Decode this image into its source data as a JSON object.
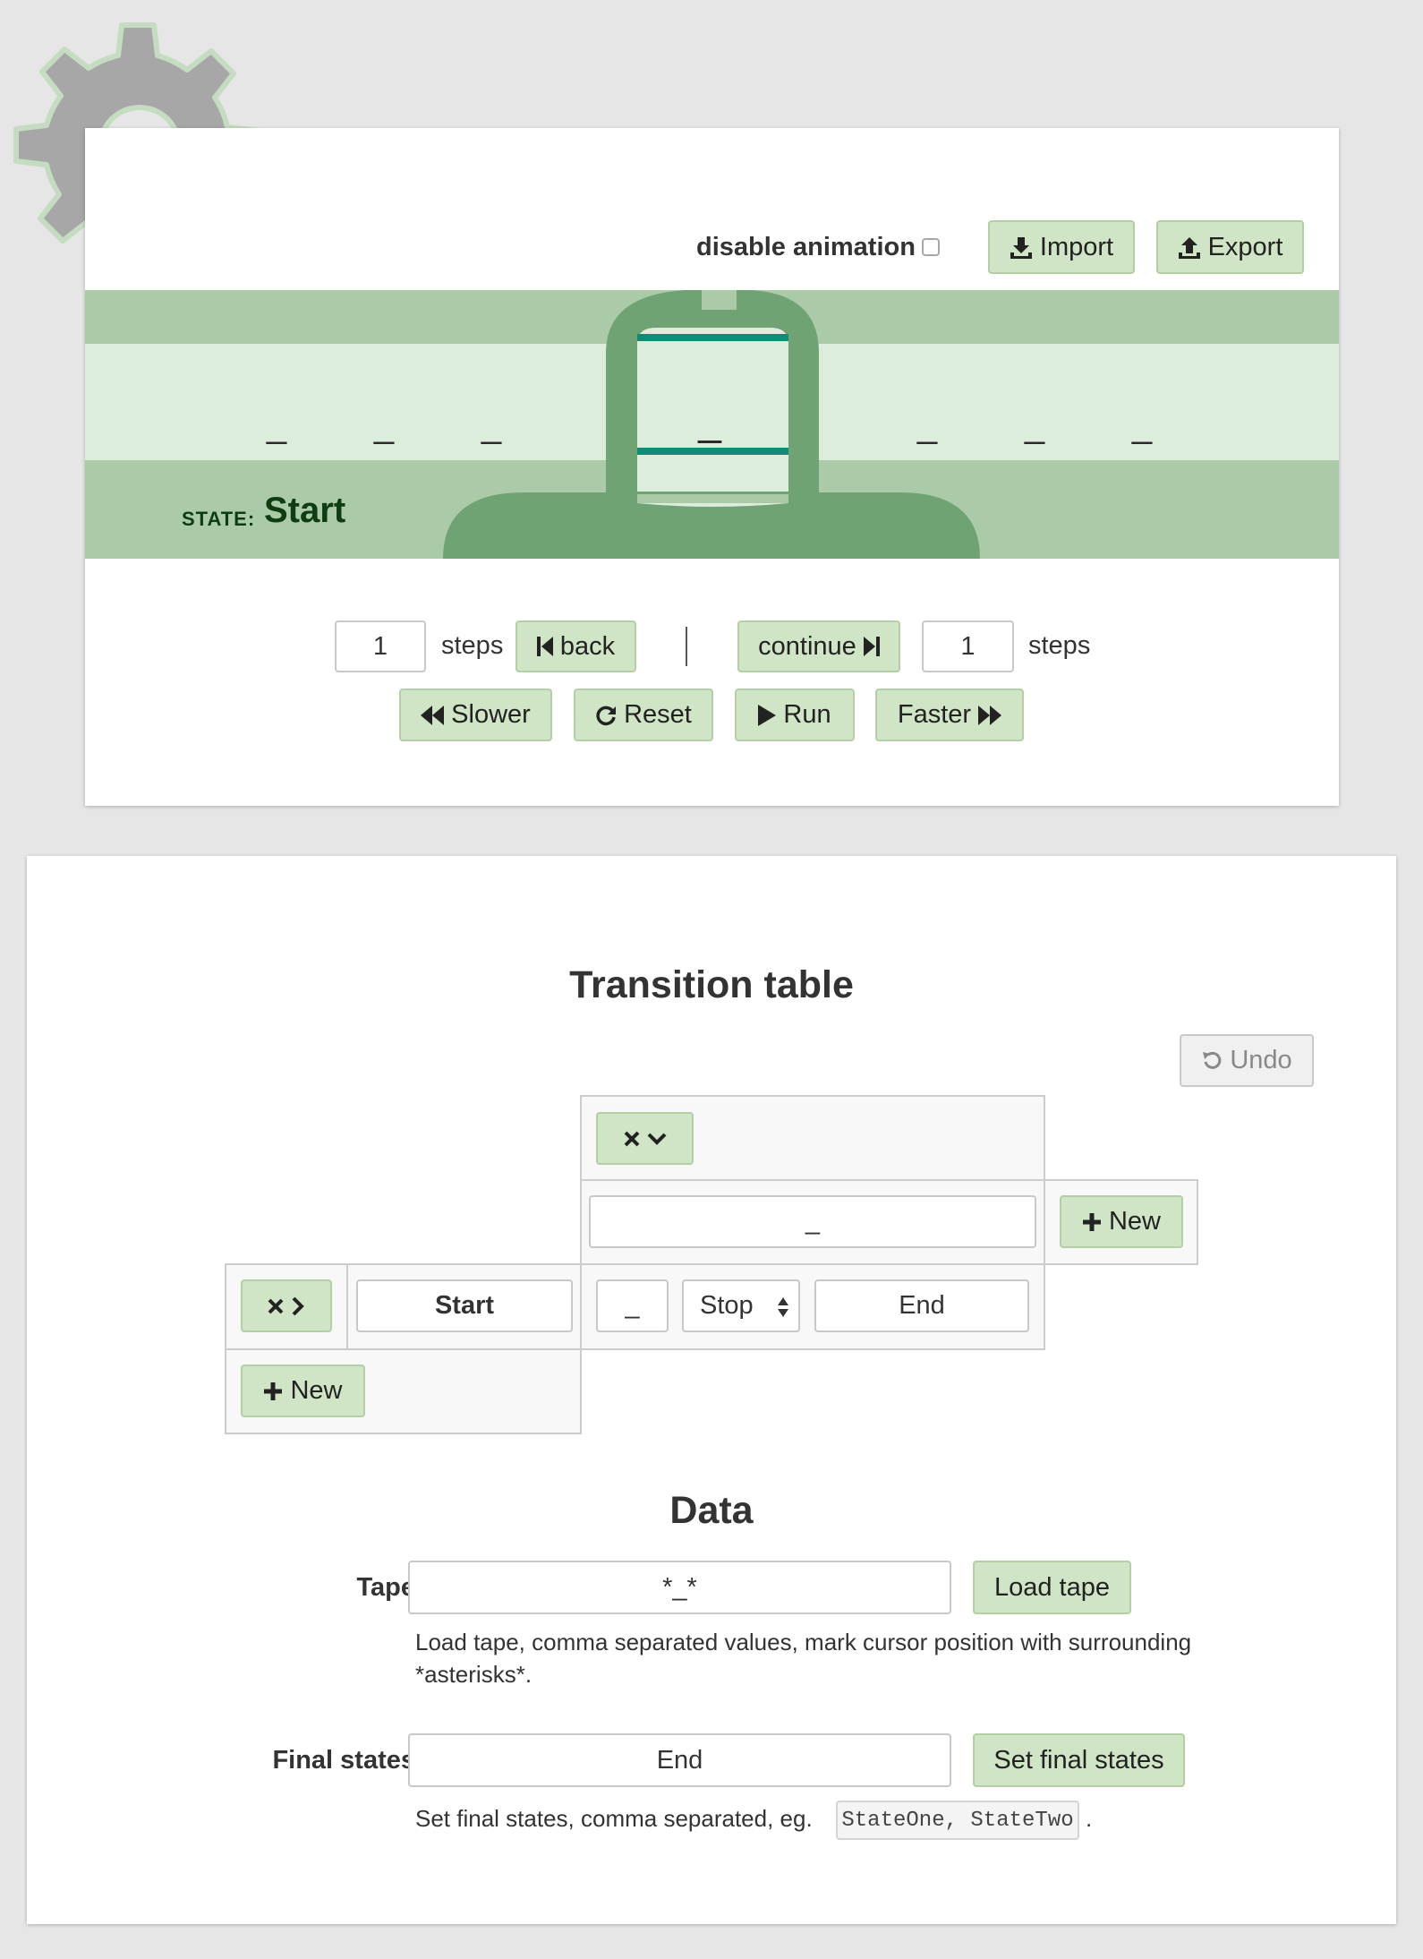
{
  "toolbar": {
    "disable_animation_label": "disable animation",
    "disable_animation_checked": false,
    "import_label": "Import",
    "export_label": "Export"
  },
  "machine": {
    "tape_symbols": [
      "_",
      "_",
      "_",
      "_",
      "_",
      "_",
      "_"
    ],
    "current_index": 3,
    "state_label": "STATE:",
    "state_value": "Start"
  },
  "controls": {
    "back_steps_value": "1",
    "back_steps_label": "steps",
    "back_label": "back",
    "continue_label": "continue",
    "continue_steps_value": "1",
    "continue_steps_label": "steps",
    "slower_label": "Slower",
    "reset_label": "Reset",
    "run_label": "Run",
    "faster_label": "Faster"
  },
  "transition_table": {
    "title": "Transition table",
    "undo_label": "Undo",
    "column_symbol": "_",
    "new_column_label": "New",
    "rows": [
      {
        "state": "Start",
        "write": "_",
        "move": "Stop",
        "next_state": "End"
      }
    ],
    "new_row_label": "New"
  },
  "data_section": {
    "title": "Data",
    "tape_label": "Tape",
    "tape_value": "*_*",
    "load_tape_label": "Load tape",
    "tape_help": "Load tape, comma separated values, mark cursor position with surrounding *asterisks*.",
    "final_states_label": "Final states",
    "final_states_value": "End",
    "set_final_states_label": "Set final states",
    "final_states_help_prefix": "Set final states, comma separated, eg.",
    "final_states_example": "StateOne, StateTwo",
    "final_states_help_suffix": "."
  },
  "colors": {
    "button_bg": "#cfe5c5",
    "band_dark": "#aacaa8",
    "band_light": "#ddeddc",
    "head": "#6fa374",
    "head_accent": "#118a78",
    "state_text": "#0f3d12"
  }
}
